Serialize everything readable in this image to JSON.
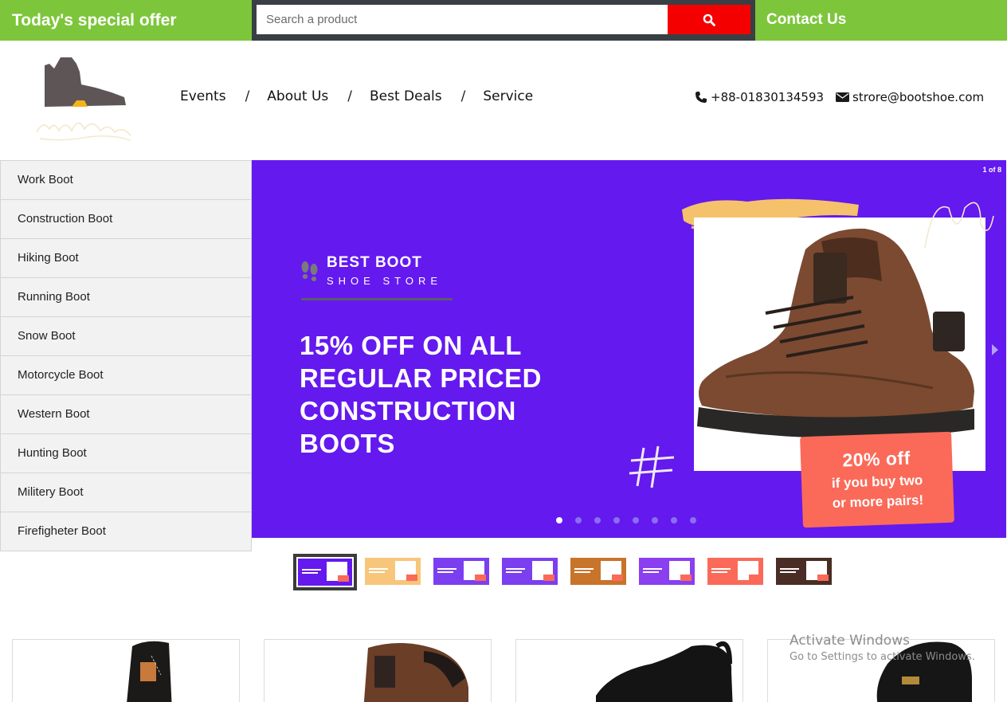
{
  "topbar": {
    "offer": "Today's special offer",
    "search_placeholder": "Search a product",
    "contact": "Contact Us"
  },
  "nav": {
    "items": [
      "Events",
      "About Us",
      "Best Deals",
      "Service"
    ],
    "separator": "/"
  },
  "contact_info": {
    "phone": "+88-01830134593",
    "email": "strore@bootshoe.com"
  },
  "categories": [
    "Work Boot",
    "Construction Boot",
    "Hiking Boot",
    "Running Boot",
    "Snow Boot",
    "Motorcycle Boot",
    "Western Boot",
    "Hunting Boot",
    "Militery Boot",
    "Firefigheter Boot"
  ],
  "slider": {
    "counter": "1 of 8",
    "brand_title": "BEST BOOT",
    "brand_sub": "SHOE STORE",
    "headline": [
      "15% OFF ON ALL",
      "REGULAR PRICED",
      "CONSTRUCTION",
      "BOOTS"
    ],
    "promo_big": "20% off",
    "promo_small": [
      "if you buy two",
      "or more pairs!"
    ],
    "active_slide": 1,
    "total_slides": 8,
    "bg_color": "#6419ef"
  },
  "thumbnails": {
    "colors": [
      "#6419ef",
      "#f7c67a",
      "#7b3ff0",
      "#7b3ff0",
      "#c8742a",
      "#8a3ff0",
      "#fb6a59",
      "#4a2d24"
    ]
  },
  "watermark": {
    "line1": "Activate Windows",
    "line2": "Go to Settings to activate Windows."
  },
  "colors": {
    "accent_green": "#7dc63b",
    "search_red": "#f40000",
    "promo_coral": "#fb6a59"
  }
}
